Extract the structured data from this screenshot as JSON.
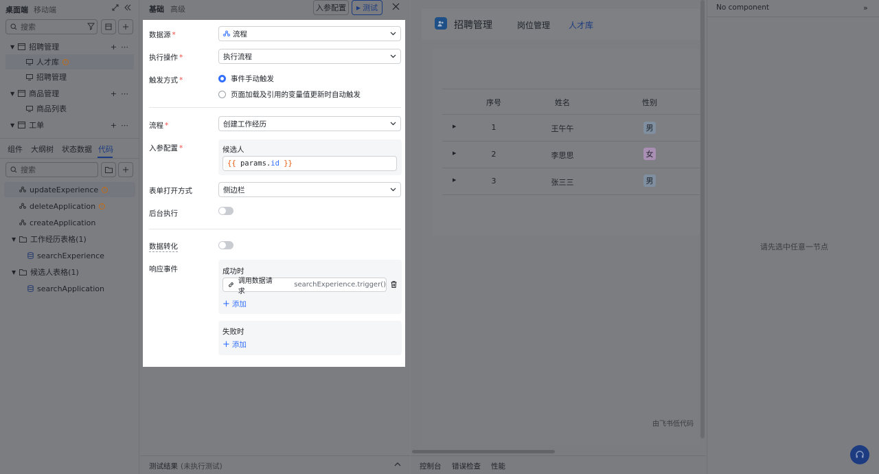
{
  "left": {
    "tabs_top": [
      "桌面端",
      "移动端"
    ],
    "search_placeholder": "搜索",
    "tree": [
      {
        "label": "招聘管理",
        "level": 0
      },
      {
        "label": "人才库",
        "level": 1,
        "warn": true
      },
      {
        "label": "招聘管理",
        "level": 1
      },
      {
        "label": "商品管理",
        "level": 0
      },
      {
        "label": "商品列表",
        "level": 1
      },
      {
        "label": "工单",
        "level": 0
      }
    ],
    "tabs_bottom": [
      "组件",
      "大纲树",
      "状态数据",
      "代码"
    ],
    "active_bottom_tab": "代码",
    "code_search_placeholder": "搜索",
    "code_items": [
      {
        "label": "updateExperience",
        "warn": true
      },
      {
        "label": "deleteApplication",
        "warn": true
      },
      {
        "label": "createApplication",
        "warn": false
      }
    ],
    "folders": [
      {
        "label": "工作经历表格(1)",
        "child": "searchExperience"
      },
      {
        "label": "候选人表格(1)",
        "child": "searchApplication"
      }
    ]
  },
  "mid": {
    "tabs": [
      "基础",
      "高级"
    ],
    "btn_params": "入参配置",
    "btn_test": "测试",
    "test_result_label": "测试结果",
    "test_result_status": "(未执行测试)"
  },
  "form": {
    "datasource_label": "数据源",
    "datasource_value": "流程",
    "action_label": "执行操作",
    "action_value": "执行流程",
    "trigger_label": "触发方式",
    "trigger_options": [
      "事件手动触发",
      "页面加载及引用的变量值更新时自动触发"
    ],
    "trigger_selected": 0,
    "flow_label": "流程",
    "flow_value": "创建工作经历",
    "input_label": "入参配置",
    "input_param_name": "候选人",
    "input_expr_open": "{{",
    "input_expr_obj": "params.",
    "input_expr_prop": "id",
    "input_expr_close": "}}",
    "form_open_label": "表单打开方式",
    "form_open_value": "侧边栏",
    "background_label": "后台执行",
    "transform_label": "数据转化",
    "events_label": "响应事件",
    "success_label": "成功时",
    "success_action_name": "调用数据请求",
    "success_action_code": "searchExperience.trigger()",
    "add_label": "添加",
    "fail_label": "失败时"
  },
  "canvas": {
    "app_title": "招聘管理",
    "nav": [
      "岗位管理",
      "人才库"
    ],
    "active_nav": "人才库",
    "table_headers": [
      "序号",
      "姓名",
      "性别"
    ],
    "rows": [
      {
        "no": "1",
        "name": "王午午",
        "gender": "男"
      },
      {
        "no": "2",
        "name": "李思思",
        "gender": "女"
      },
      {
        "no": "3",
        "name": "张三三",
        "gender": "男"
      }
    ],
    "watermark": "由飞书低代码",
    "bottom_tabs": [
      "控制台",
      "错误检查",
      "性能"
    ]
  },
  "right": {
    "title": "No component",
    "hint": "请先选中任意一节点"
  },
  "colors": {
    "accent": "#3370ff",
    "required": "#f54a45",
    "warn": "#f5a623",
    "male_tag": "#7f8fa0",
    "female_tag": "#a98fb3"
  }
}
